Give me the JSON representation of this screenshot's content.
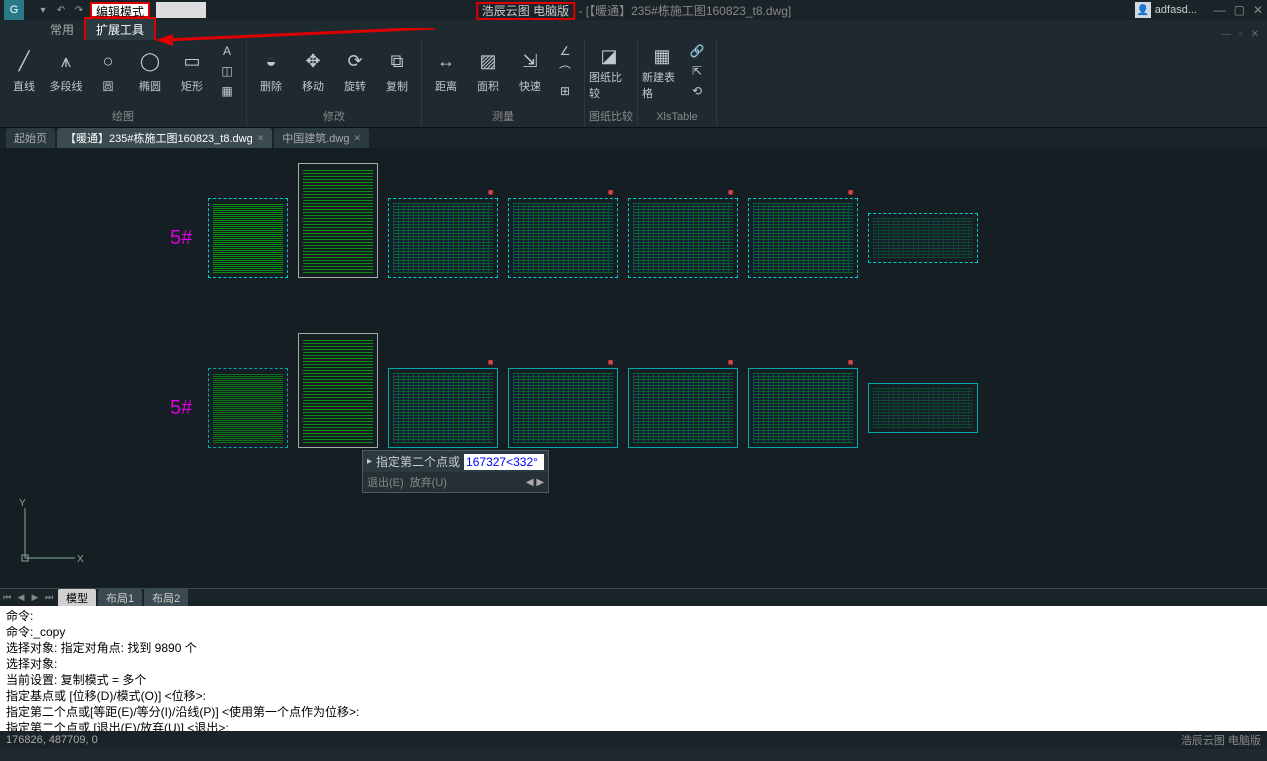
{
  "titlebar": {
    "mode_label": "编辑模式",
    "app_name": "浩辰云图 电脑版",
    "doc_title": "- [【暖通】235#栋施工图160823_t8.dwg]",
    "user": "adfasd..."
  },
  "menu": {
    "tab_common": "常用",
    "tab_extend": "扩展工具"
  },
  "ribbon": {
    "line": "直线",
    "pline": "多段线",
    "circle": "圆",
    "ellipse": "椭圆",
    "rect": "矩形",
    "group_draw": "绘图",
    "erase": "删除",
    "move": "移动",
    "rotate": "旋转",
    "copy": "复制",
    "group_modify": "修改",
    "dist": "距离",
    "area": "面积",
    "quick": "快速",
    "group_measure": "测量",
    "dwgcmp": "图纸比较",
    "newtable": "新建表格",
    "group_dwgcmp": "图纸比较",
    "group_xls": "XlsTable"
  },
  "doctabs": {
    "start": "起始页",
    "active": "【暖通】235#栋施工图160823_t8.dwg",
    "other": "中国建筑.dwg"
  },
  "canvas": {
    "row_label": "5#"
  },
  "dyninput": {
    "prompt": "指定第二个点或",
    "value": "167327<332°",
    "opt_exit": "退出(E)",
    "opt_abandon": "放弃(U)"
  },
  "layout": {
    "model": "模型",
    "layout1": "布局1",
    "layout2": "布局2"
  },
  "cmd": {
    "l1": "命令:",
    "l2": "命令:_copy",
    "l3": "选择对象: 指定对角点: 找到  9890 个",
    "l4": "选择对象:",
    "l5": "当前设置:    复制模式 = 多个",
    "l6": "指定基点或 [位移(D)/模式(O)] <位移>:",
    "l7": "指定第二个点或[等距(E)/等分(I)/沿线(P)] <使用第一个点作为位移>:",
    "l8": "指定第二个点或 [退出(E)/放弃(U)] <退出>:"
  },
  "status": {
    "coords": "176826, 487709, 0",
    "brand": "浩辰云图 电脑版"
  }
}
